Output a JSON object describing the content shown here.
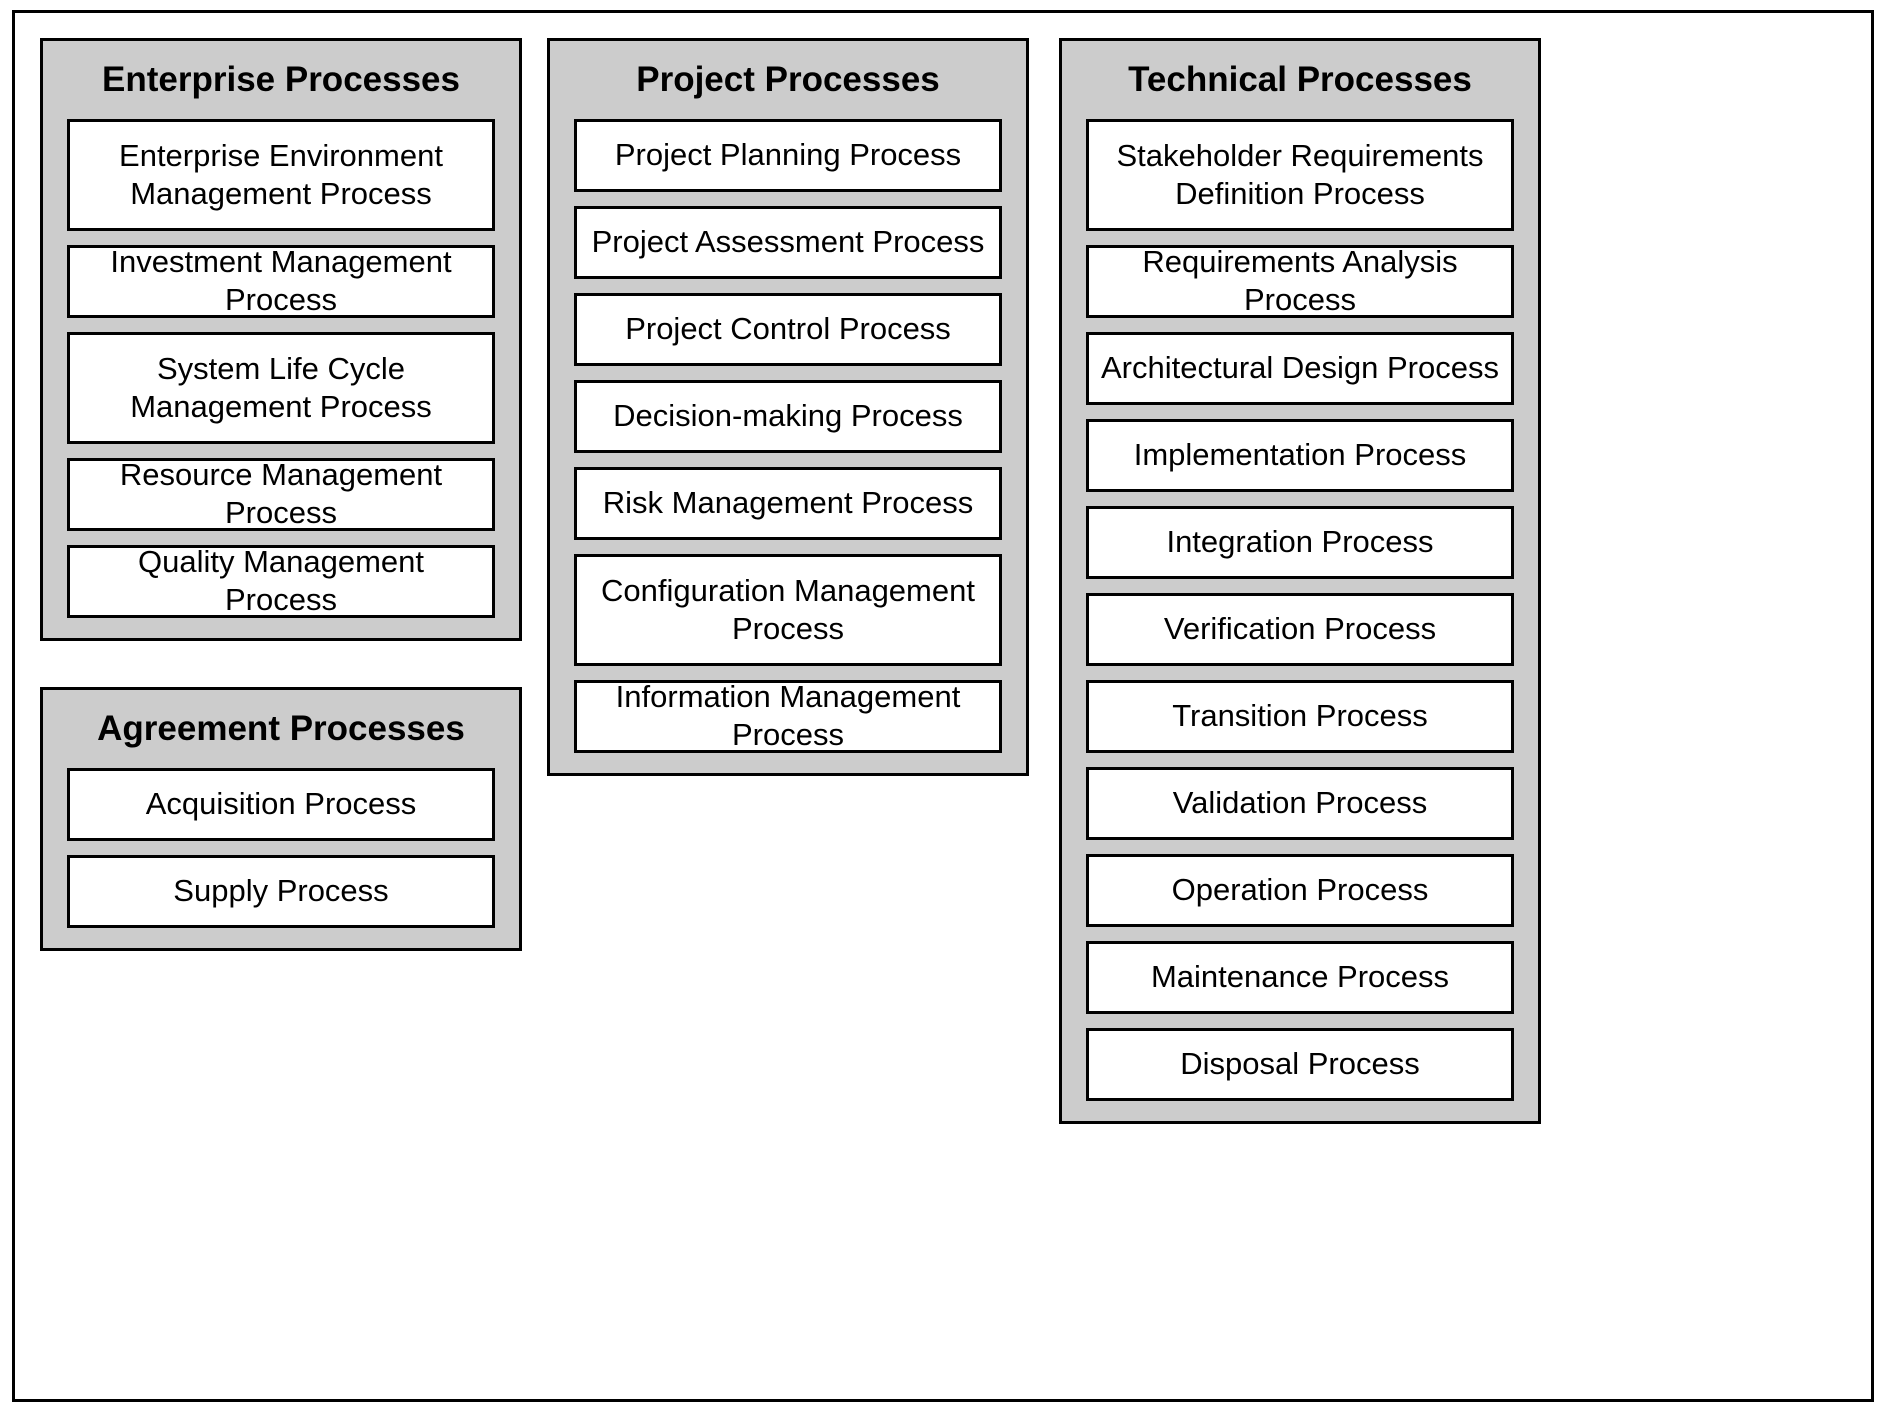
{
  "diagram": {
    "title_visible": false,
    "colors": {
      "group_fill": "#cccccc",
      "process_fill": "#ffffff",
      "border": "#000000",
      "text": "#000000"
    },
    "columns": [
      {
        "id": "left",
        "groups": [
          {
            "id": "enterprise",
            "title": "Enterprise Processes",
            "processes": [
              {
                "label": "Enterprise Environment Management Process",
                "lines": 2
              },
              {
                "label": "Investment Management Process",
                "lines": 1
              },
              {
                "label": "System Life Cycle Management Process",
                "lines": 2
              },
              {
                "label": "Resource Management Process",
                "lines": 1
              },
              {
                "label": "Quality Management Process",
                "lines": 1
              }
            ]
          },
          {
            "id": "agreement",
            "title": "Agreement Processes",
            "processes": [
              {
                "label": "Acquisition Process",
                "lines": 1
              },
              {
                "label": "Supply Process",
                "lines": 1
              }
            ]
          }
        ]
      },
      {
        "id": "middle",
        "groups": [
          {
            "id": "project",
            "title": "Project Processes",
            "processes": [
              {
                "label": "Project Planning Process",
                "lines": 1
              },
              {
                "label": "Project Assessment Process",
                "lines": 1
              },
              {
                "label": "Project Control Process",
                "lines": 1
              },
              {
                "label": "Decision-making Process",
                "lines": 1
              },
              {
                "label": "Risk Management Process",
                "lines": 1
              },
              {
                "label": "Configuration Management Process",
                "lines": 2
              },
              {
                "label": "Information Management Process",
                "lines": 1
              }
            ]
          }
        ]
      },
      {
        "id": "right",
        "groups": [
          {
            "id": "technical",
            "title": "Technical Processes",
            "processes": [
              {
                "label": "Stakeholder Requirements Definition Process",
                "lines": 2
              },
              {
                "label": "Requirements Analysis Process",
                "lines": 1
              },
              {
                "label": "Architectural Design Process",
                "lines": 1
              },
              {
                "label": "Implementation Process",
                "lines": 1
              },
              {
                "label": "Integration Process",
                "lines": 1
              },
              {
                "label": "Verification Process",
                "lines": 1
              },
              {
                "label": "Transition Process",
                "lines": 1
              },
              {
                "label": "Validation Process",
                "lines": 1
              },
              {
                "label": "Operation Process",
                "lines": 1
              },
              {
                "label": "Maintenance Process",
                "lines": 1
              },
              {
                "label": "Disposal Process",
                "lines": 1
              }
            ]
          }
        ]
      }
    ]
  }
}
